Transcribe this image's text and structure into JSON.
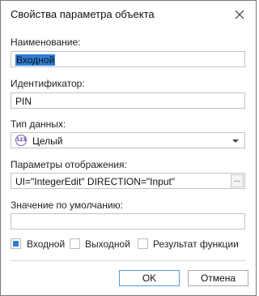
{
  "window": {
    "title": "Свойства параметра объекта",
    "close_icon": "close-icon"
  },
  "fields": {
    "name": {
      "label": "Наименование:",
      "value": "Входной"
    },
    "identifier": {
      "label": "Идентификатор:",
      "value": "PIN"
    },
    "data_type": {
      "label": "Тип данных:",
      "value": "Целый",
      "icon": "integer-type-icon",
      "icon_text": "123"
    },
    "display_params": {
      "label": "Параметры отображения:",
      "value": "UI=\"IntegerEdit\" DIRECTION=\"Input\"",
      "button_label": "..."
    },
    "default_value": {
      "label": "Значение по умолчанию:",
      "value": ""
    }
  },
  "direction": {
    "input": {
      "label": "Входной",
      "checked": true
    },
    "output": {
      "label": "Выходной",
      "checked": false
    },
    "function_result": {
      "label": "Результат функции",
      "checked": false
    }
  },
  "buttons": {
    "ok": "OK",
    "cancel": "Отмена"
  },
  "colors": {
    "accent": "#2f7ed8",
    "type_icon": "#7b5fb5"
  }
}
